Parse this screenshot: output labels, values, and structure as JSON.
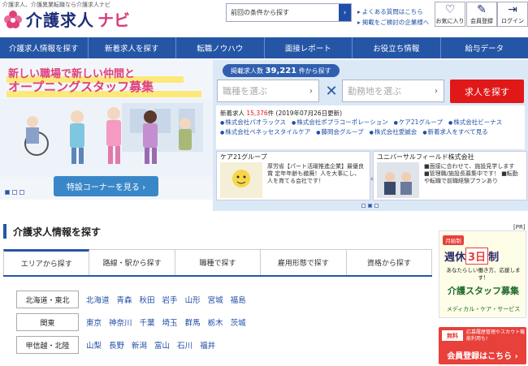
{
  "header": {
    "tagline": "介護求人、介護異業転職なら介護求人ナビ",
    "logo_text": "介護求人",
    "logo_navi": "ナビ",
    "search_placeholder": "前回の条件から探す",
    "links": [
      "よくある質問はこちら",
      "掲載をご検討の企業様へ"
    ],
    "buttons": [
      {
        "label": "お気に入り",
        "icon": "heart-icon"
      },
      {
        "label": "会員登録",
        "icon": "edit-icon"
      },
      {
        "label": "ログイン",
        "icon": "login-icon"
      }
    ]
  },
  "nav": {
    "items": [
      "介護求人情報を探す",
      "新着求人を探す",
      "転職ノウハウ",
      "面接レポート",
      "お役立ち情報",
      "給与データ"
    ]
  },
  "hero": {
    "line1": "新しい職場で新しい仲間と",
    "line2": "オープニングスタッフ募集",
    "button": "特設コーナーを見る ›"
  },
  "search": {
    "count_prefix": "掲載求人数",
    "count": "39,221",
    "count_suffix": "件から探す",
    "job_type_placeholder": "職種を選ぶ",
    "location_placeholder": "勤務地を選ぶ",
    "submit": "求人を探す"
  },
  "new_jobs": {
    "label": "新着求人",
    "count": "15,376",
    "suffix": "件 (2019年07月26日更新)",
    "companies": [
      "株式会社パオラックス",
      "株式会社ポプラコーポレーション",
      "ケア21グループ",
      "株式会社ビーナス",
      "株式会社ベネッセスタイルケア",
      "藤岡会グループ",
      "株式会社愛誠会",
      "新着求人をすべて見る"
    ]
  },
  "cards": [
    {
      "title": "ケア21グループ",
      "text": "厚労省【パート活躍推進企業】最優良賞 定年年齢も撤廃！人を大事にし、人を育てる会社です！"
    },
    {
      "title": "ユニバーサルフィールド株式会社",
      "text": "■面接に合わせて、施設見学します ■管理職/施設長募集中です！ ■転勤や転職で前職経験プランあり"
    }
  ],
  "section": {
    "title": "介護求人情報を探す",
    "tabs": [
      "エリアから探す",
      "路線・駅から探す",
      "職種で探す",
      "雇用形態で探す",
      "資格から探す"
    ],
    "regions": [
      {
        "label": "北海道・東北",
        "prefs": [
          "北海道",
          "青森",
          "秋田",
          "岩手",
          "山形",
          "宮城",
          "福島"
        ]
      },
      {
        "label": "関東",
        "prefs": [
          "東京",
          "神奈川",
          "千葉",
          "埼玉",
          "群馬",
          "栃木",
          "茨城"
        ]
      },
      {
        "label": "甲信越・北陸",
        "prefs": [
          "山梨",
          "長野",
          "新潟",
          "富山",
          "石川",
          "福井"
        ]
      }
    ]
  },
  "ads": {
    "pr": "[PR]",
    "ad1_tag": "月給制",
    "ad1_big_pre": "週休",
    "ad1_big_box": "3日",
    "ad1_big_post": "制",
    "ad1_sub": "あなたらしい働き方、応援します！",
    "ad1_main": "介護スタッフ募集",
    "ad1_foot": "メディカル・ケア・サービス",
    "ad2_free": "無料",
    "ad2_note": "応募履歴管理やスカウト機能利用も!",
    "ad2_main": "会員登録はこちら ›"
  },
  "colors": {
    "brand_blue": "#2556a6",
    "accent_red": "#e01818",
    "pink": "#e0407a"
  }
}
